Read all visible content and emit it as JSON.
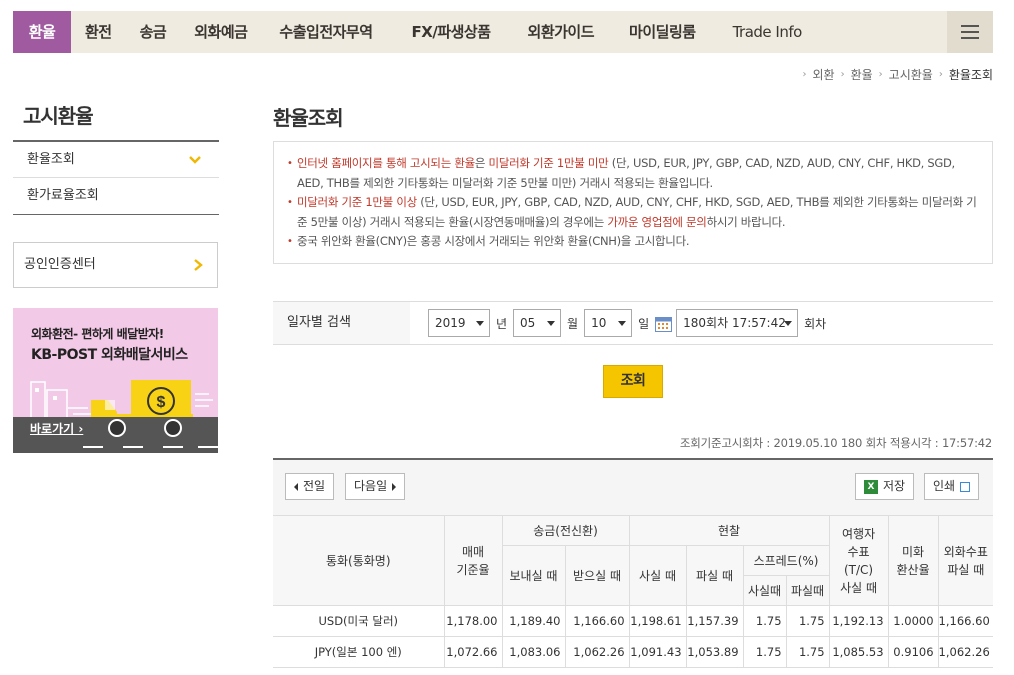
{
  "nav": {
    "items": [
      "환율",
      "환전",
      "송금",
      "외화예금",
      "수출입전자무역",
      "FX/파생상품",
      "외환가이드",
      "마이딜링룸",
      "Trade Info"
    ]
  },
  "breadcrumb": {
    "items": [
      "외환",
      "환율",
      "고시환율",
      "환율조회"
    ]
  },
  "sidebar": {
    "title": "고시환율",
    "menu": [
      "환율조회",
      "환가료율조회"
    ],
    "cert_label": "공인인증센터",
    "banner": {
      "line1": "외화환전- 편하게 배달받자!",
      "line2": "KB-POST 외화배달서비스",
      "go": "바로가기 ›"
    }
  },
  "main": {
    "title": "환율조회",
    "notice": {
      "p1_red": "인터넷 홈페이지를 통해 고시되는 환율",
      "p1_mid": "은 ",
      "p1_red2": "미달러화 기준 1만불 미만",
      "p1_rest": " (단, USD, EUR, JPY, GBP, CAD, NZD, AUD, CNY, CHF, HKD, SGD, AED, THB를 제외한 기타통화는 미달러화 기준 5만불 미만) 거래시 적용되는 환율입니다.",
      "p2_red": "미달러화 기준 1만불 이상",
      "p2_mid": " (단, USD, EUR, JPY, GBP, CAD, NZD, AUD, CNY, CHF, HKD, SGD, AED, THB를 제외한 기타통화는 미달러화 기준 5만불 이상) 거래시 적용되는 환율(시장연동매매율)의 경우에는 ",
      "p2_red2": "가까운 영업점에 문의",
      "p2_rest": "하시기 바랍니다.",
      "p3": "중국 위안화 환율(CNY)은 홍콩 시장에서 거래되는 위안화 환율(CNH)을 고시합니다."
    },
    "search": {
      "label": "일자별 검색",
      "year": "2019",
      "year_unit": "년",
      "month": "05",
      "month_unit": "월",
      "day": "10",
      "day_unit": "일",
      "round": "180회차 17:57:42",
      "round_unit": "회차",
      "button": "조회"
    },
    "notice_time": "조회기준고시회차 : 2019.05.10 180 회차   적용시각 : 17:57:42",
    "toolbar": {
      "prev": "전일",
      "next": "다음일",
      "save": "저장",
      "print": "인쇄"
    },
    "table": {
      "headers": {
        "currency": "통화(통화명)",
        "base": "매매\n기준율",
        "remit": "송금(전신환)",
        "remit_send": "보내실 때",
        "remit_recv": "받으실 때",
        "cash": "현찰",
        "cash_buy": "사실 때",
        "cash_sell": "파실 때",
        "spread": "스프레드(%)",
        "spread_buy": "사실때",
        "spread_sell": "파실때",
        "tc": "여행자\n수표\n(T/C)\n사실 때",
        "usd_rate": "미화\n환산율",
        "check_sell": "외화수표\n파실 때"
      },
      "rows": [
        [
          "USD(미국 달러)",
          "1,178.00",
          "1,189.40",
          "1,166.60",
          "1,198.61",
          "1,157.39",
          "1.75",
          "1.75",
          "1,192.13",
          "1.0000",
          "1,166.60"
        ],
        [
          "JPY(일본 100 엔)",
          "1,072.66",
          "1,083.06",
          "1,062.26",
          "1,091.43",
          "1,053.89",
          "1.75",
          "1.75",
          "1,085.53",
          "0.9106",
          "1,062.26"
        ]
      ]
    }
  },
  "colors": {
    "nav_bg": "#f0ebe1",
    "nav_active": "#a05aa0",
    "accent_red": "#c0392b",
    "query_button": "#f5c500",
    "chevron_yellow": "#f0b800"
  }
}
